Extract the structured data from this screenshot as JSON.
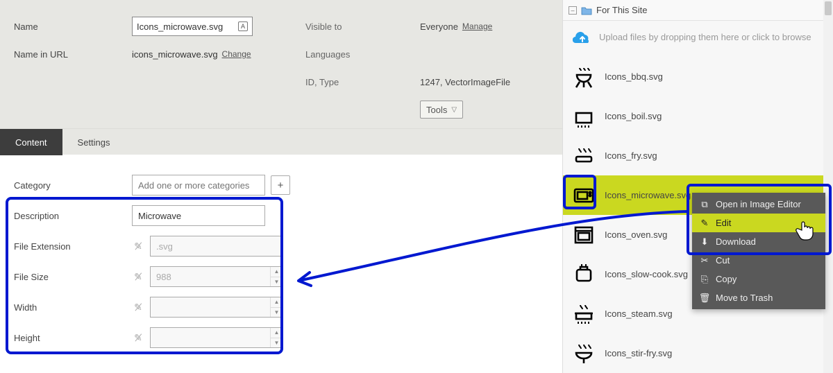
{
  "header": {
    "labels": {
      "name": "Name",
      "name_in_url": "Name in URL",
      "visible_to": "Visible to",
      "languages": "Languages",
      "id_type": "ID, Type"
    },
    "values": {
      "name": "Icons_microwave.svg",
      "name_in_url": "icons_microwave.svg",
      "change": "Change",
      "visible_to": "Everyone",
      "manage": "Manage",
      "id_type": "1247, VectorImageFile",
      "tools": "Tools"
    }
  },
  "tabs": {
    "content": "Content",
    "settings": "Settings"
  },
  "form": {
    "labels": {
      "category": "Category",
      "description": "Description",
      "file_extension": "File Extension",
      "file_size": "File Size",
      "width": "Width",
      "height": "Height"
    },
    "values": {
      "category_placeholder": "Add one or more categories",
      "description": "Microwave",
      "file_extension": ".svg",
      "file_size": "988",
      "width": "",
      "height": ""
    }
  },
  "sidebar": {
    "title": "For This Site",
    "upload_hint": "Upload files by dropping them here or click to browse",
    "files": [
      {
        "label": "Icons_bbq.svg",
        "icon": "bbq"
      },
      {
        "label": "Icons_boil.svg",
        "icon": "boil"
      },
      {
        "label": "Icons_fry.svg",
        "icon": "fry"
      },
      {
        "label": "Icons_microwave.svg",
        "icon": "microwave"
      },
      {
        "label": "Icons_oven.svg",
        "icon": "oven"
      },
      {
        "label": "Icons_slow-cook.svg",
        "icon": "slowcook"
      },
      {
        "label": "Icons_steam.svg",
        "icon": "steam"
      },
      {
        "label": "Icons_stir-fry.svg",
        "icon": "stirfry"
      }
    ],
    "selected_index": 3
  },
  "context_menu": {
    "items": [
      {
        "label": "Open in Image Editor",
        "icon": "open"
      },
      {
        "label": "Edit",
        "icon": "edit"
      },
      {
        "label": "Download",
        "icon": "download"
      },
      {
        "label": "Cut",
        "icon": "cut"
      },
      {
        "label": "Copy",
        "icon": "copy"
      },
      {
        "label": "Move to Trash",
        "icon": "trash"
      }
    ],
    "hovered_index": 1
  }
}
